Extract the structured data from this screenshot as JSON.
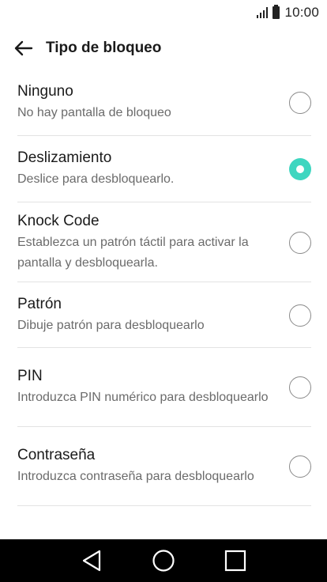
{
  "status_bar": {
    "time": "10:00",
    "signal_icon": "signal-bars-icon",
    "battery_icon": "battery-icon"
  },
  "app_bar": {
    "title": "Tipo de bloqueo",
    "back_icon": "arrow-left-icon"
  },
  "options": [
    {
      "title": "Ninguno",
      "subtitle": "No hay pantalla de bloqueo",
      "selected": false
    },
    {
      "title": "Deslizamiento",
      "subtitle": "Deslice para desbloquearlo.",
      "selected": true
    },
    {
      "title": "Knock Code",
      "subtitle": "Establezca un patrón táctil para activar la pantalla y desbloquearla.",
      "selected": false
    },
    {
      "title": "Patrón",
      "subtitle": "Dibuje patrón para desbloquearlo",
      "selected": false
    },
    {
      "title": "PIN",
      "subtitle": "Introduzca PIN numérico para desbloquearlo",
      "selected": false
    },
    {
      "title": "Contraseña",
      "subtitle": "Introduzca contraseña para desbloquearlo",
      "selected": false
    }
  ],
  "nav_bar": {
    "back_icon": "triangle-back-icon",
    "home_icon": "circle-home-icon",
    "recents_icon": "square-recents-icon"
  },
  "colors": {
    "accent": "#3ed6c0",
    "nav_background": "#000000",
    "divider": "#e3e3e3",
    "subtitle_text": "#6b6b6b"
  }
}
